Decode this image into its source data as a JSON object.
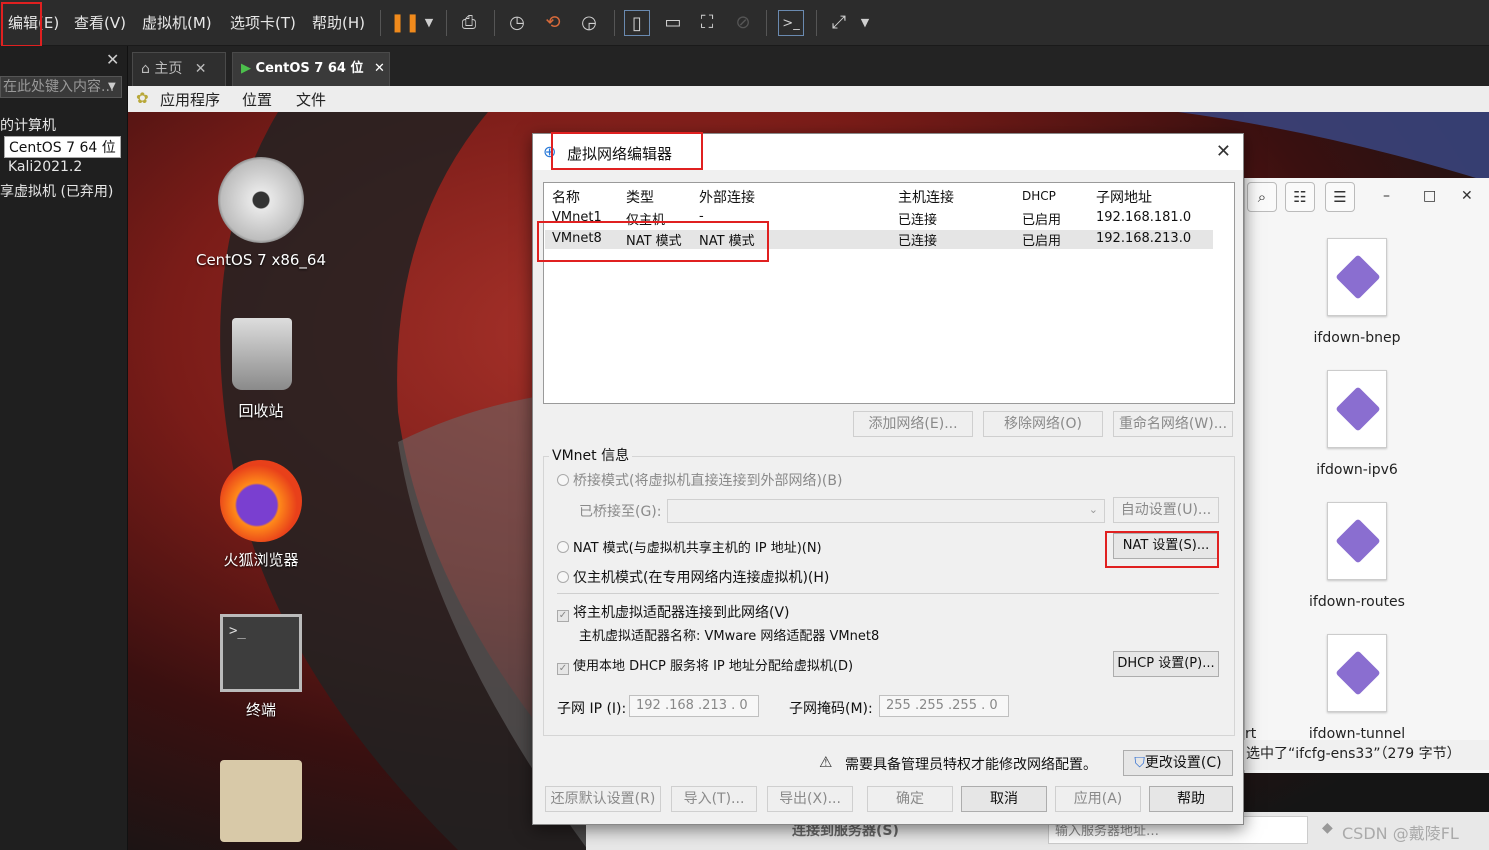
{
  "menubar": {
    "items": [
      "编辑(E)",
      "查看(V)",
      "虚拟机(M)",
      "选项卡(T)",
      "帮助(H)"
    ]
  },
  "library": {
    "search_placeholder": "在此处键入内容...",
    "items": [
      "的计算机",
      "CentOS 7 64 位",
      "Kali2021.2",
      "享虚拟机 (已弃用)"
    ]
  },
  "tabs": [
    {
      "label": "主页"
    },
    {
      "label": "CentOS 7 64 位"
    }
  ],
  "guest_bar": {
    "items": [
      "应用程序",
      "位置",
      "文件"
    ]
  },
  "desktop": {
    "icons": [
      {
        "label": "CentOS 7 x86_64",
        "icon": "disc-icon"
      },
      {
        "label": "回收站",
        "icon": "trash-icon"
      },
      {
        "label": "火狐浏览器",
        "icon": "firefox-icon"
      },
      {
        "label": "终端",
        "icon": "terminal-icon"
      }
    ]
  },
  "file_window": {
    "files": [
      "ifdown-bnep",
      "ifdown-ipv6",
      "ifdown-routes",
      "ifdown-tunnel"
    ],
    "status": "选中了“ifcfg-ens33”（279 字节）",
    "partial_text": "rt"
  },
  "bottom_strip": {
    "left_text": "连接到服务器(S)",
    "input_placeholder": "输入服务器地址…",
    "watermark": "CSDN @戴陵FL"
  },
  "dialog": {
    "title": "虚拟网络编辑器",
    "columns": [
      "名称",
      "类型",
      "外部连接",
      "主机连接",
      "DHCP",
      "子网地址"
    ],
    "rows": [
      [
        "VMnet1",
        "仅主机",
        "-",
        "已连接",
        "已启用",
        "192.168.181.0"
      ],
      [
        "VMnet8",
        "NAT 模式",
        "NAT 模式",
        "已连接",
        "已启用",
        "192.168.213.0"
      ]
    ],
    "add_network": "添加网络(E)...",
    "remove_network": "移除网络(O)",
    "rename_network": "重命名网络(W)...",
    "vmnet_info": "VMnet 信息",
    "bridge_mode": "桥接模式(将虚拟机直接连接到外部网络)(B)",
    "bridged_to": "已桥接至(G):",
    "auto_settings": "自动设置(U)...",
    "nat_mode": "NAT 模式(与虚拟机共享主机的 IP 地址)(N)",
    "nat_settings": "NAT 设置(S)...",
    "host_only": "仅主机模式(在专用网络内连接虚拟机)(H)",
    "connect_adapter": "将主机虚拟适配器连接到此网络(V)",
    "adapter_name": "主机虚拟适配器名称: VMware 网络适配器 VMnet8",
    "use_dhcp": "使用本地 DHCP 服务将 IP 地址分配给虚拟机(D)",
    "dhcp_settings": "DHCP 设置(P)...",
    "subnet_ip_label": "子网 IP (I):",
    "subnet_ip": "192 .168 .213 .  0",
    "subnet_mask_label": "子网掩码(M):",
    "subnet_mask": "255 .255 .255 .  0",
    "admin_notice": "需要具备管理员特权才能修改网络配置。",
    "change_settings": "更改设置(C)",
    "restore_defaults": "还原默认设置(R)",
    "import": "导入(T)...",
    "export": "导出(X)...",
    "ok": "确定",
    "cancel": "取消",
    "apply": "应用(A)",
    "help": "帮助"
  },
  "colors": {
    "highlight_box": "#e02020",
    "menubar_bg": "#2c2c2c",
    "dialog_bg": "#f0f0f0"
  }
}
